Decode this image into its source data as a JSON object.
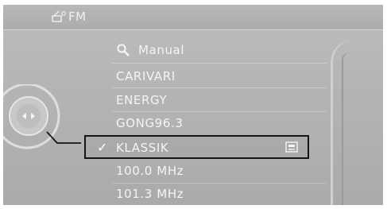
{
  "header": {
    "icon": "radio-antenna-icon",
    "title": "FM"
  },
  "menu": {
    "search_icon": "search-icon",
    "manual_label": "Manual",
    "items": [
      {
        "label": "CARIVARI"
      },
      {
        "label": "ENERGY"
      },
      {
        "label": "GONG96.3"
      },
      {
        "label": "KLASSIK",
        "selected": true,
        "check": "✓",
        "icon": "stored-station-icon"
      },
      {
        "label": "100.0 MHz"
      },
      {
        "label": "101.3 MHz"
      }
    ]
  },
  "controller": {
    "icon": "idrive-controller-icon"
  },
  "colors": {
    "background": "#b4b4b4",
    "text": "#f4f4f4",
    "highlight_border": "#151515"
  }
}
